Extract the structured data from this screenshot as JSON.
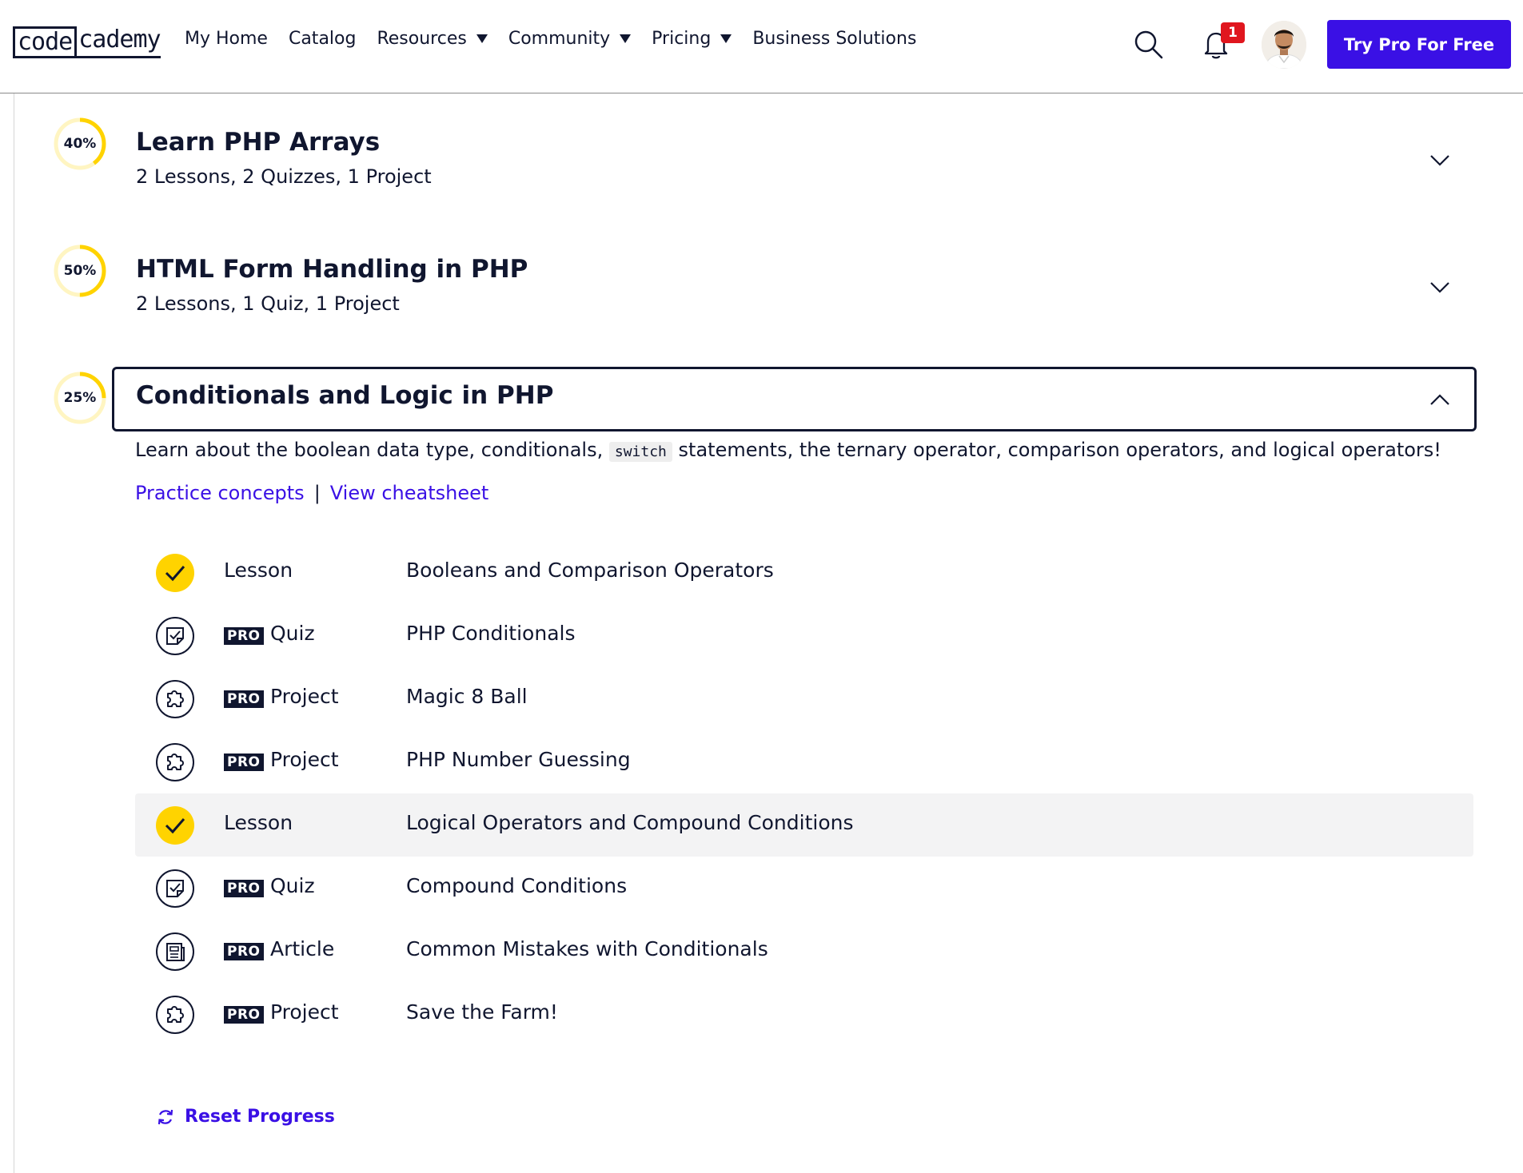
{
  "header": {
    "logo_code": "code",
    "logo_rest": "cademy",
    "nav": [
      {
        "label": "My Home",
        "dropdown": false
      },
      {
        "label": "Catalog",
        "dropdown": false
      },
      {
        "label": "Resources",
        "dropdown": true
      },
      {
        "label": "Community",
        "dropdown": true
      },
      {
        "label": "Pricing",
        "dropdown": true
      },
      {
        "label": "Business Solutions",
        "dropdown": false
      }
    ],
    "notification_count": "1",
    "cta_label": "Try Pro For Free"
  },
  "modules": [
    {
      "progress_label": "40%",
      "progress": 0.4,
      "title": "Learn PHP Arrays",
      "subtitle": "2 Lessons, 2 Quizzes, 1 Project",
      "expanded": false
    },
    {
      "progress_label": "50%",
      "progress": 0.5,
      "title": "HTML Form Handling in PHP",
      "subtitle": "2 Lessons, 1 Quiz, 1 Project",
      "expanded": false
    },
    {
      "progress_label": "25%",
      "progress": 0.25,
      "title": "Conditionals and Logic in PHP",
      "expanded": true
    }
  ],
  "expanded_module": {
    "description_before": "Learn about the boolean data type, conditionals,",
    "description_code": "switch",
    "description_after": "statements, the ternary operator, comparison operators, and logical operators!",
    "link_practice": "Practice concepts",
    "link_separator": "|",
    "link_cheatsheet": "View cheatsheet",
    "pro_badge": "PRO",
    "items": [
      {
        "type": "Lesson",
        "title": "Booleans and Comparison Operators",
        "pro": false,
        "completed": true,
        "icon": "check-icon"
      },
      {
        "type": "Quiz",
        "title": "PHP Conditionals",
        "pro": true,
        "completed": false,
        "icon": "quiz-icon"
      },
      {
        "type": "Project",
        "title": "Magic 8 Ball",
        "pro": true,
        "completed": false,
        "icon": "puzzle-icon"
      },
      {
        "type": "Project",
        "title": "PHP Number Guessing",
        "pro": true,
        "completed": false,
        "icon": "puzzle-icon"
      },
      {
        "type": "Lesson",
        "title": "Logical Operators and Compound Conditions",
        "pro": false,
        "completed": true,
        "icon": "check-icon",
        "highlighted": true
      },
      {
        "type": "Quiz",
        "title": "Compound Conditions",
        "pro": true,
        "completed": false,
        "icon": "quiz-icon"
      },
      {
        "type": "Article",
        "title": "Common Mistakes with Conditionals",
        "pro": true,
        "completed": false,
        "icon": "article-icon"
      },
      {
        "type": "Project",
        "title": "Save the Farm!",
        "pro": true,
        "completed": false,
        "icon": "puzzle-icon"
      }
    ],
    "reset_label": "Reset Progress"
  },
  "colors": {
    "accent": "#3a10e5",
    "navy": "#10162f",
    "progress_yellow": "#ffd300",
    "progress_track": "#fff5c2",
    "badge_red": "#e0161e"
  }
}
